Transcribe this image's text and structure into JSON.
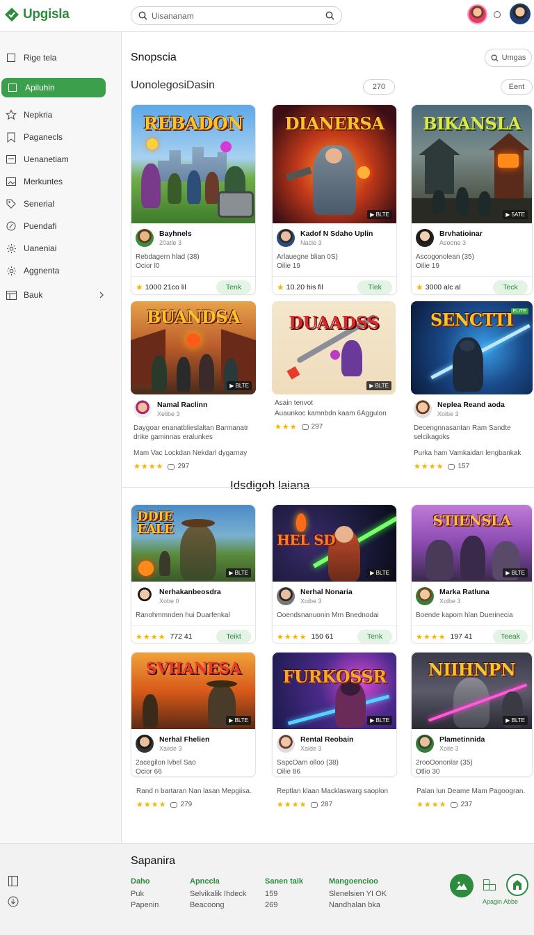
{
  "header": {
    "app_name": "Upgisla",
    "search_placeholder": "Uisananam"
  },
  "sidebar": {
    "items": [
      {
        "label": "Rige tela",
        "icon": "square-icon"
      },
      {
        "label": "Apiluhin",
        "icon": "square-icon",
        "active": true
      },
      {
        "label": "Nepkria",
        "icon": "star-icon"
      },
      {
        "label": "Paganecls",
        "icon": "bookmark-icon"
      },
      {
        "label": "Uenanetiam",
        "icon": "card-icon"
      },
      {
        "label": "Merkuntes",
        "icon": "image-icon"
      },
      {
        "label": "Senerial",
        "icon": "tag-icon"
      },
      {
        "label": "Puendafi",
        "icon": "compass-icon"
      },
      {
        "label": "Uaneniai",
        "icon": "gear-icon"
      },
      {
        "label": "Aggnenta",
        "icon": "gear-icon"
      },
      {
        "label": "Bauk",
        "icon": "store-icon"
      }
    ]
  },
  "main": {
    "title": "Snopscia",
    "top_pill": "Umgas",
    "subtitle": "UonolegosiDasin",
    "pill_count": "270",
    "pill_filter": "Eent",
    "section2_title": "Idsdigoh laiana",
    "row1": [
      {
        "cover_title": "REBADON",
        "cover_badge": "",
        "name": "Bayhnels",
        "sub": "20atle 3",
        "desc": "Rebdagern hlad (38)",
        "desc2": "Ocior l0",
        "rating": "1000 21co lil",
        "button": "Tenk"
      },
      {
        "cover_title": "DIANERSA",
        "cover_badge": "▶ BLTE",
        "name": "Kadof N Sdaho Uplin",
        "sub": "Nacle 3",
        "desc": "Arlauegne blian 0S)",
        "desc2": "Oilie 19",
        "rating": "10.20 his fil",
        "button": "Tlek"
      },
      {
        "cover_title": "BIKANSLA",
        "cover_badge": "▶ 5ATE",
        "name": "Brvhatioinar",
        "sub": "Asoone 3",
        "desc": "Ascogonolean (35)",
        "desc2": "Oilie 19",
        "rating": "3000 alc al",
        "button": "Teck"
      }
    ],
    "row2": [
      {
        "cover_title": "BUANDSA",
        "cover_badge": "▶ BLTE",
        "name": "Namal Raclinn",
        "sub": "Xelibe 3",
        "desc": "Daygoar enanatblieslaltan Barmanatr drike gaminnas eralunkes",
        "foot_text": "Mam Vac Lockdan Nekdarl dygarnay",
        "count": "297"
      },
      {
        "cover_title": "DUAADSS",
        "cover_badge": "▶ BLTE",
        "name": "Asain tenvot",
        "sub": "",
        "desc": "Auaunkoc kamnbdn kaam 6Aggulon",
        "foot_text": "",
        "count": "297"
      },
      {
        "cover_title": "SENCTTI",
        "cover_badge": "",
        "name": "Neplea Reand aoda",
        "sub": "Xoibe 3",
        "desc": "Decengnnasantan Ram Sandte selcikagoks",
        "foot_text": "Purka ham Vamkaidan lengbankak",
        "count": "157"
      }
    ],
    "row3": [
      {
        "cover_title": "DDIE EALE",
        "cover_badge": "▶ BLTE",
        "name": "Nerhakanbeosdra",
        "sub": "Xobe 0",
        "desc": "Ranohmmnden hui Duarfenkal",
        "rating": "772 41",
        "button": "Teikt"
      },
      {
        "cover_title": "HEL SD",
        "cover_badge": "▶ BLTE",
        "name": "Nerhal Nonaria",
        "sub": "Xoibe 3",
        "desc": "Ooendsnanuonin Mrn Bnednodai",
        "rating": "150 61",
        "button": "Tenk"
      },
      {
        "cover_title": "STIENSLA",
        "cover_badge": "▶ BLTE",
        "name": "Marka Ratluna",
        "sub": "Xolbe 3",
        "desc": "Boende kapom hlan Duerinecia",
        "rating": "197 41",
        "button": "Teeak"
      }
    ],
    "row4": [
      {
        "cover_title": "SVHANESA",
        "cover_badge": "▶ BLTE",
        "name": "Nerhal Fhelien",
        "sub": "Xaiide 3",
        "desc": "2acegilon lvbel Sao",
        "desc2": "Ocior 66",
        "foot_text": "Rand n bartaran Nan lasan Mepgiisa.",
        "count": "279"
      },
      {
        "cover_title": "FURKOSSR",
        "cover_badge": "▶ BLTE",
        "name": "Rental Reobain",
        "sub": "Xalde 3",
        "desc": "SapcOam olloo (38)",
        "desc2": "Oilie 86",
        "foot_text": "Reptlan klaan Macklaswarg saoplon",
        "count": "287"
      },
      {
        "cover_title": "NIIHNPN",
        "cover_badge": "▶ BLTE",
        "name": "Plametinnida",
        "sub": "Xoile 3",
        "desc": "2rooOononlar (35)",
        "desc2": "Otlio 30",
        "foot_text": "Palan lun Deame Mam Pagoogran.",
        "count": "237"
      }
    ]
  },
  "footer": {
    "title": "Sapanira",
    "columns": [
      {
        "heading": "Daho",
        "lines": [
          "Puk",
          "Papenin"
        ]
      },
      {
        "heading": "Apnccla",
        "lines": [
          "Selvikalik Ihdeck",
          "Beacoong"
        ]
      },
      {
        "heading": "Sanen taik",
        "lines": [
          "159",
          "269"
        ]
      },
      {
        "heading": "Mangoencioo",
        "lines": [
          "Slenelsien YI OK",
          "Nandhalan bka"
        ]
      }
    ],
    "fab_label": "Apagin Abbe"
  },
  "colors": {
    "brand_green": "#2e8b3e",
    "active_green": "#3c9f4b",
    "button_bg": "#e3f3e5",
    "star": "#f4b400"
  }
}
